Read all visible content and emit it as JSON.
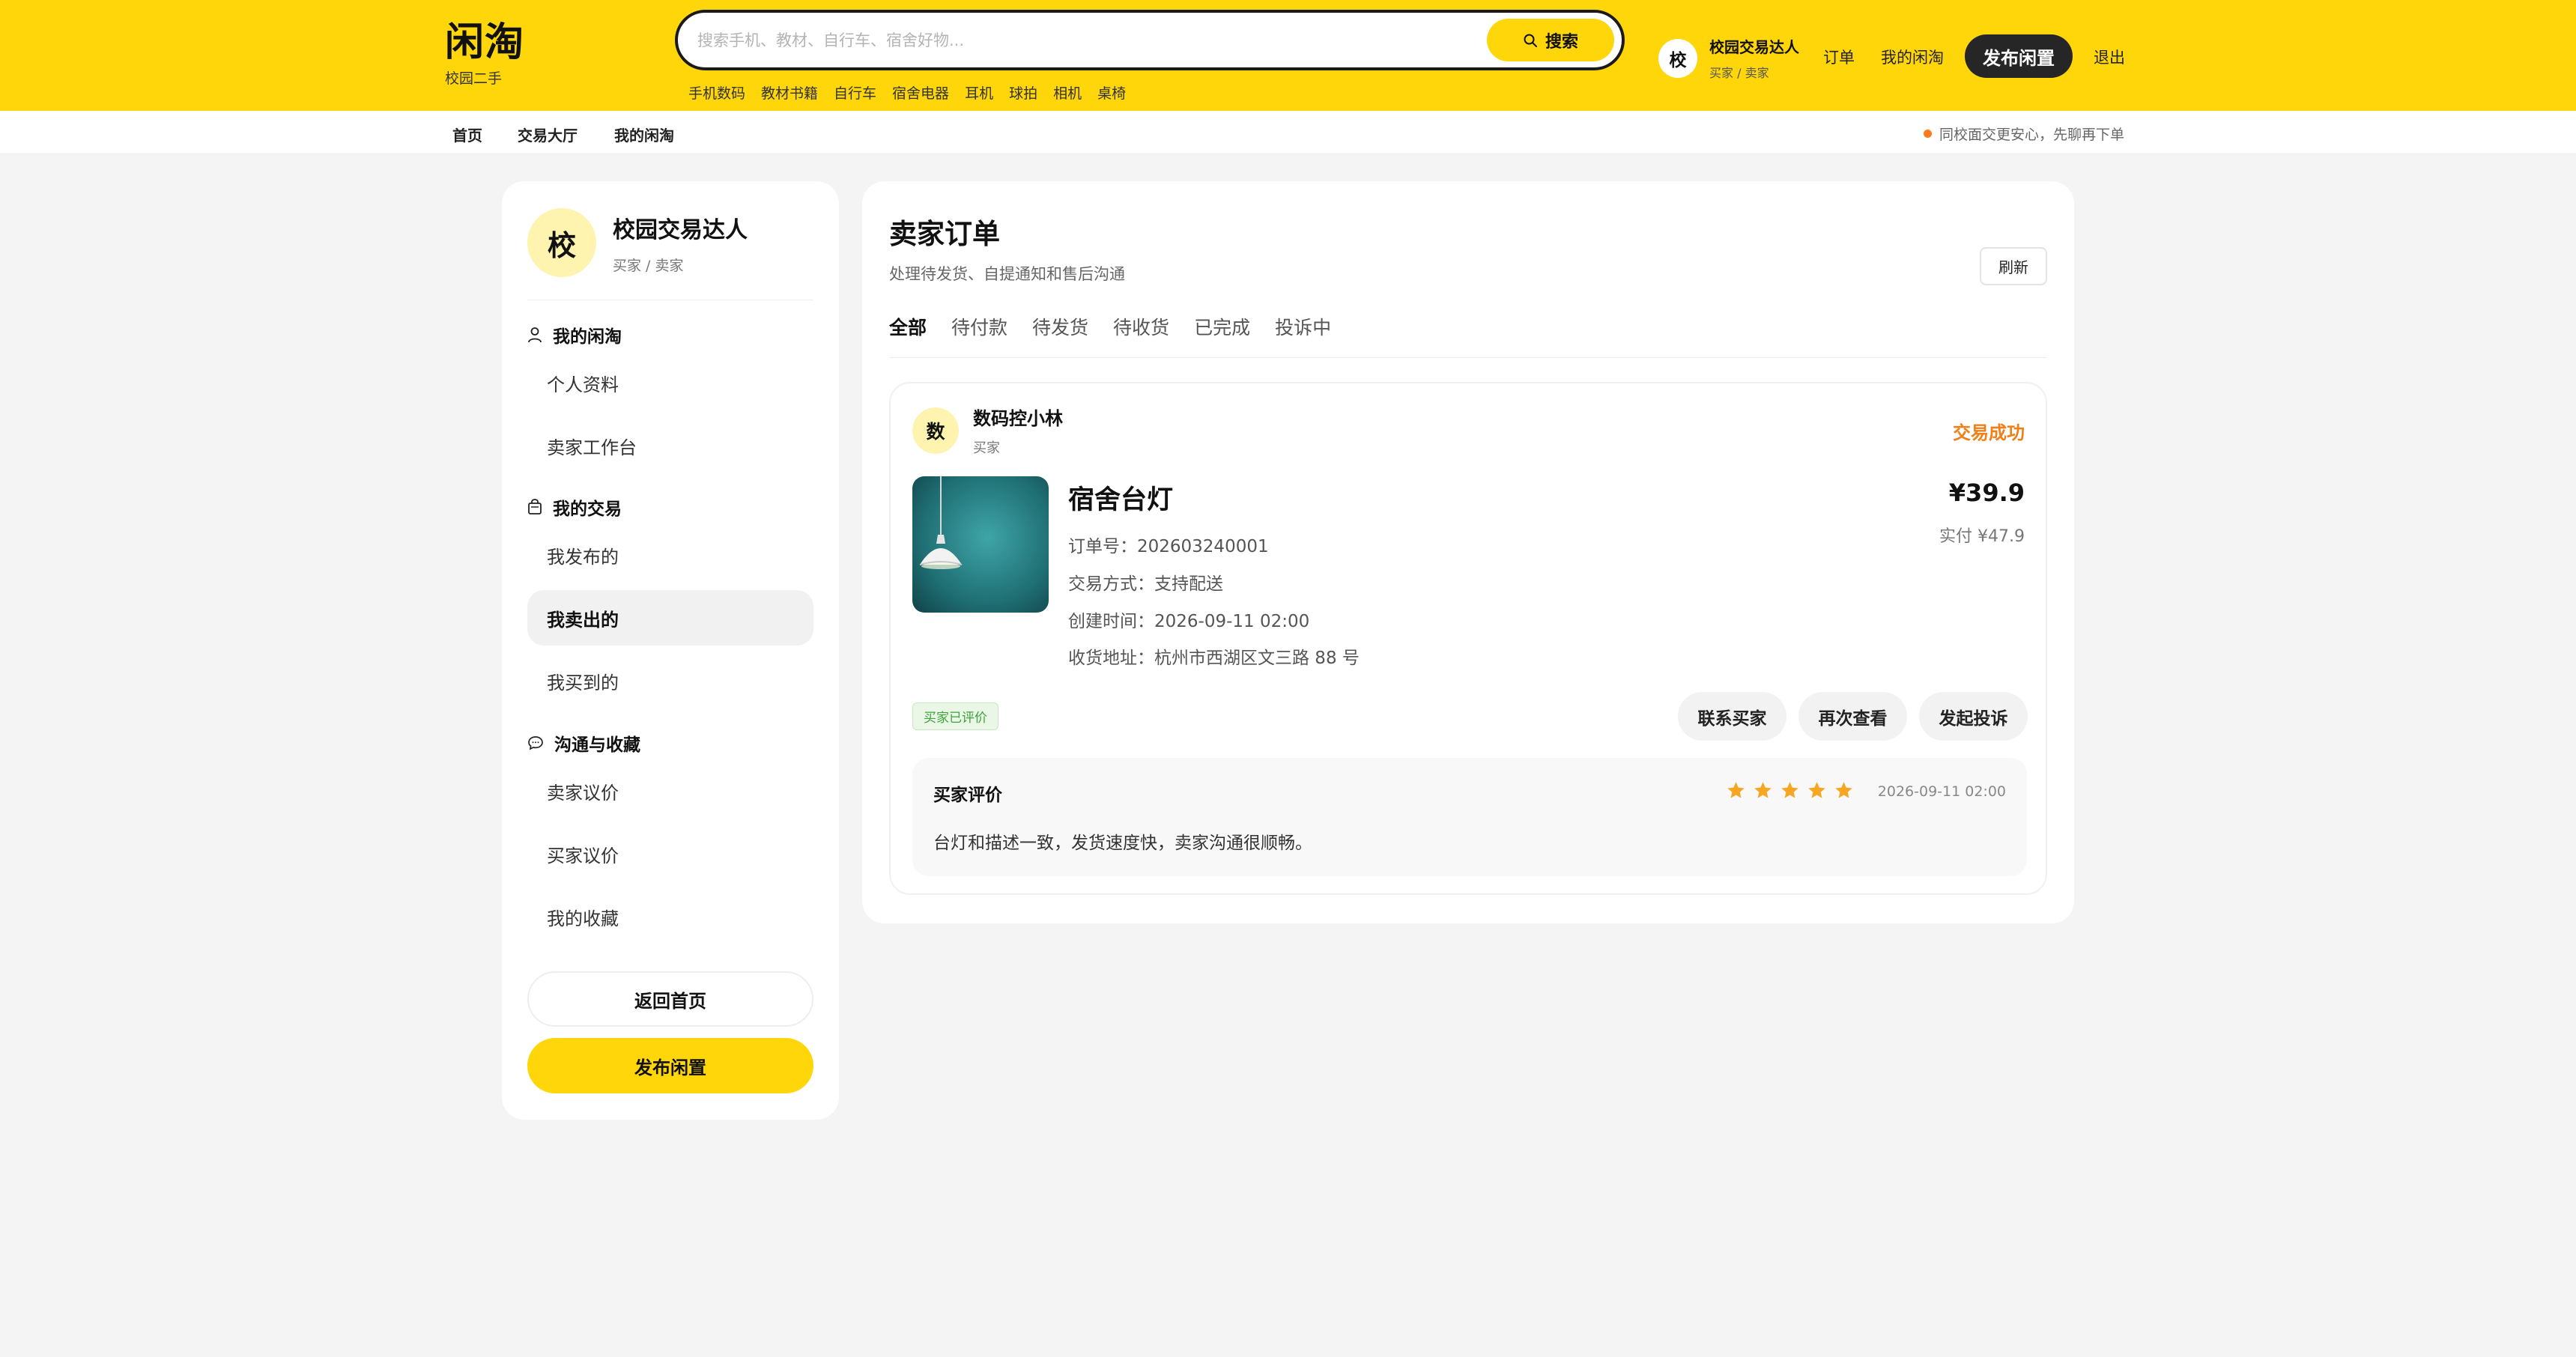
{
  "header": {
    "logo_title": "闲淘",
    "logo_subtitle": "校园二手",
    "search_placeholder": "搜索手机、教材、自行车、宿舍好物...",
    "search_button": "搜索",
    "hot_tags": [
      "手机数码",
      "教材书籍",
      "自行车",
      "宿舍电器",
      "耳机",
      "球拍",
      "相机",
      "桌椅"
    ],
    "user": {
      "avatar_char": "校",
      "name": "校园交易达人",
      "role": "买家 / 卖家"
    },
    "links": {
      "orders": "订单",
      "my_xiantao": "我的闲淘",
      "logout": "退出"
    },
    "publish_button": "发布闲置"
  },
  "subnav": {
    "links": [
      "首页",
      "交易大厅",
      "我的闲淘"
    ],
    "notice": "同校面交更安心，先聊再下单"
  },
  "sidebar": {
    "profile": {
      "avatar_char": "校",
      "name": "校园交易达人",
      "role": "买家 / 卖家"
    },
    "groups": [
      {
        "title": "我的闲淘",
        "icon": "user-icon",
        "items": [
          "个人资料",
          "卖家工作台"
        ]
      },
      {
        "title": "我的交易",
        "icon": "bag-icon",
        "items": [
          "我发布的",
          "我卖出的",
          "我买到的"
        ]
      },
      {
        "title": "沟通与收藏",
        "icon": "chat-icon",
        "items": [
          "卖家议价",
          "买家议价",
          "我的收藏"
        ]
      }
    ],
    "active_item": "我卖出的",
    "back_button": "返回首页",
    "publish_button": "发布闲置"
  },
  "main": {
    "title": "卖家订单",
    "subtitle": "处理待发货、自提通知和售后沟通",
    "refresh_button": "刷新",
    "tabs": [
      "全部",
      "待付款",
      "待发货",
      "待收货",
      "已完成",
      "投诉中"
    ],
    "active_tab": "全部",
    "order": {
      "buyer": {
        "avatar_char": "数",
        "name": "数码控小林",
        "role": "买家"
      },
      "status": "交易成功",
      "item_title": "宿舍台灯",
      "order_no": "订单号：202603240001",
      "trade_mode": "交易方式：支持配送",
      "created_at": "创建时间：2026-09-11 02:00",
      "address": "收货地址：杭州市西湖区文三路 88 号",
      "price": "¥39.9",
      "paid": "实付 ¥47.9",
      "rated_badge": "买家已评价",
      "actions": [
        "联系买家",
        "再次查看",
        "发起投诉"
      ],
      "review": {
        "title": "买家评价",
        "rating": 5,
        "time": "2026-09-11 02:00",
        "text": "台灯和描述一致，发货速度快，卖家沟通很顺畅。"
      }
    }
  },
  "colors": {
    "brand_yellow": "#ffd60a",
    "status_orange": "#f07f18",
    "badge_green": "#3ea33a",
    "star": "#f5a623"
  }
}
